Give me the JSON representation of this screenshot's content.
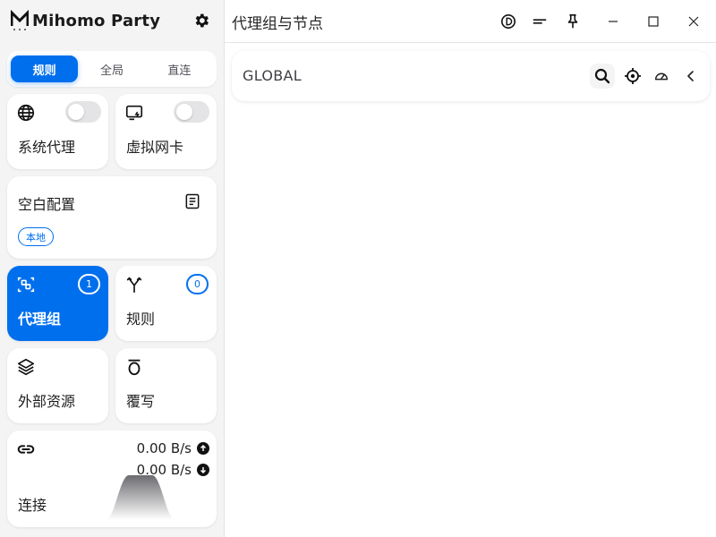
{
  "app": {
    "name": "Mihomo Party"
  },
  "mode_tabs": [
    {
      "label": "规则",
      "active": true
    },
    {
      "label": "全局",
      "active": false
    },
    {
      "label": "直连",
      "active": false
    }
  ],
  "cards": {
    "system_proxy": {
      "label": "系统代理",
      "icon": "globe-icon",
      "enabled": false
    },
    "tun": {
      "label": "虚拟网卡",
      "icon": "tun-icon",
      "enabled": false
    },
    "profile": {
      "name": "空白配置",
      "tag": "本地",
      "icon": "document-icon"
    },
    "proxy_groups": {
      "label": "代理组",
      "count": "1",
      "active": true,
      "icon": "proxy-group-icon"
    },
    "rules": {
      "label": "规则",
      "count": "0",
      "icon": "rules-fork-icon"
    },
    "resources": {
      "label": "外部资源",
      "icon": "layers-icon"
    },
    "override": {
      "label": "覆写",
      "icon": "override-icon"
    },
    "connections": {
      "label": "连接",
      "upload": "0.00 B/s",
      "download": "0.00 B/s",
      "icon": "link-icon"
    }
  },
  "main": {
    "title": "代理组与节点",
    "group": {
      "name": "GLOBAL"
    }
  },
  "colors": {
    "accent": "#006FEE",
    "sidebar_bg": "#f4f4f5"
  }
}
